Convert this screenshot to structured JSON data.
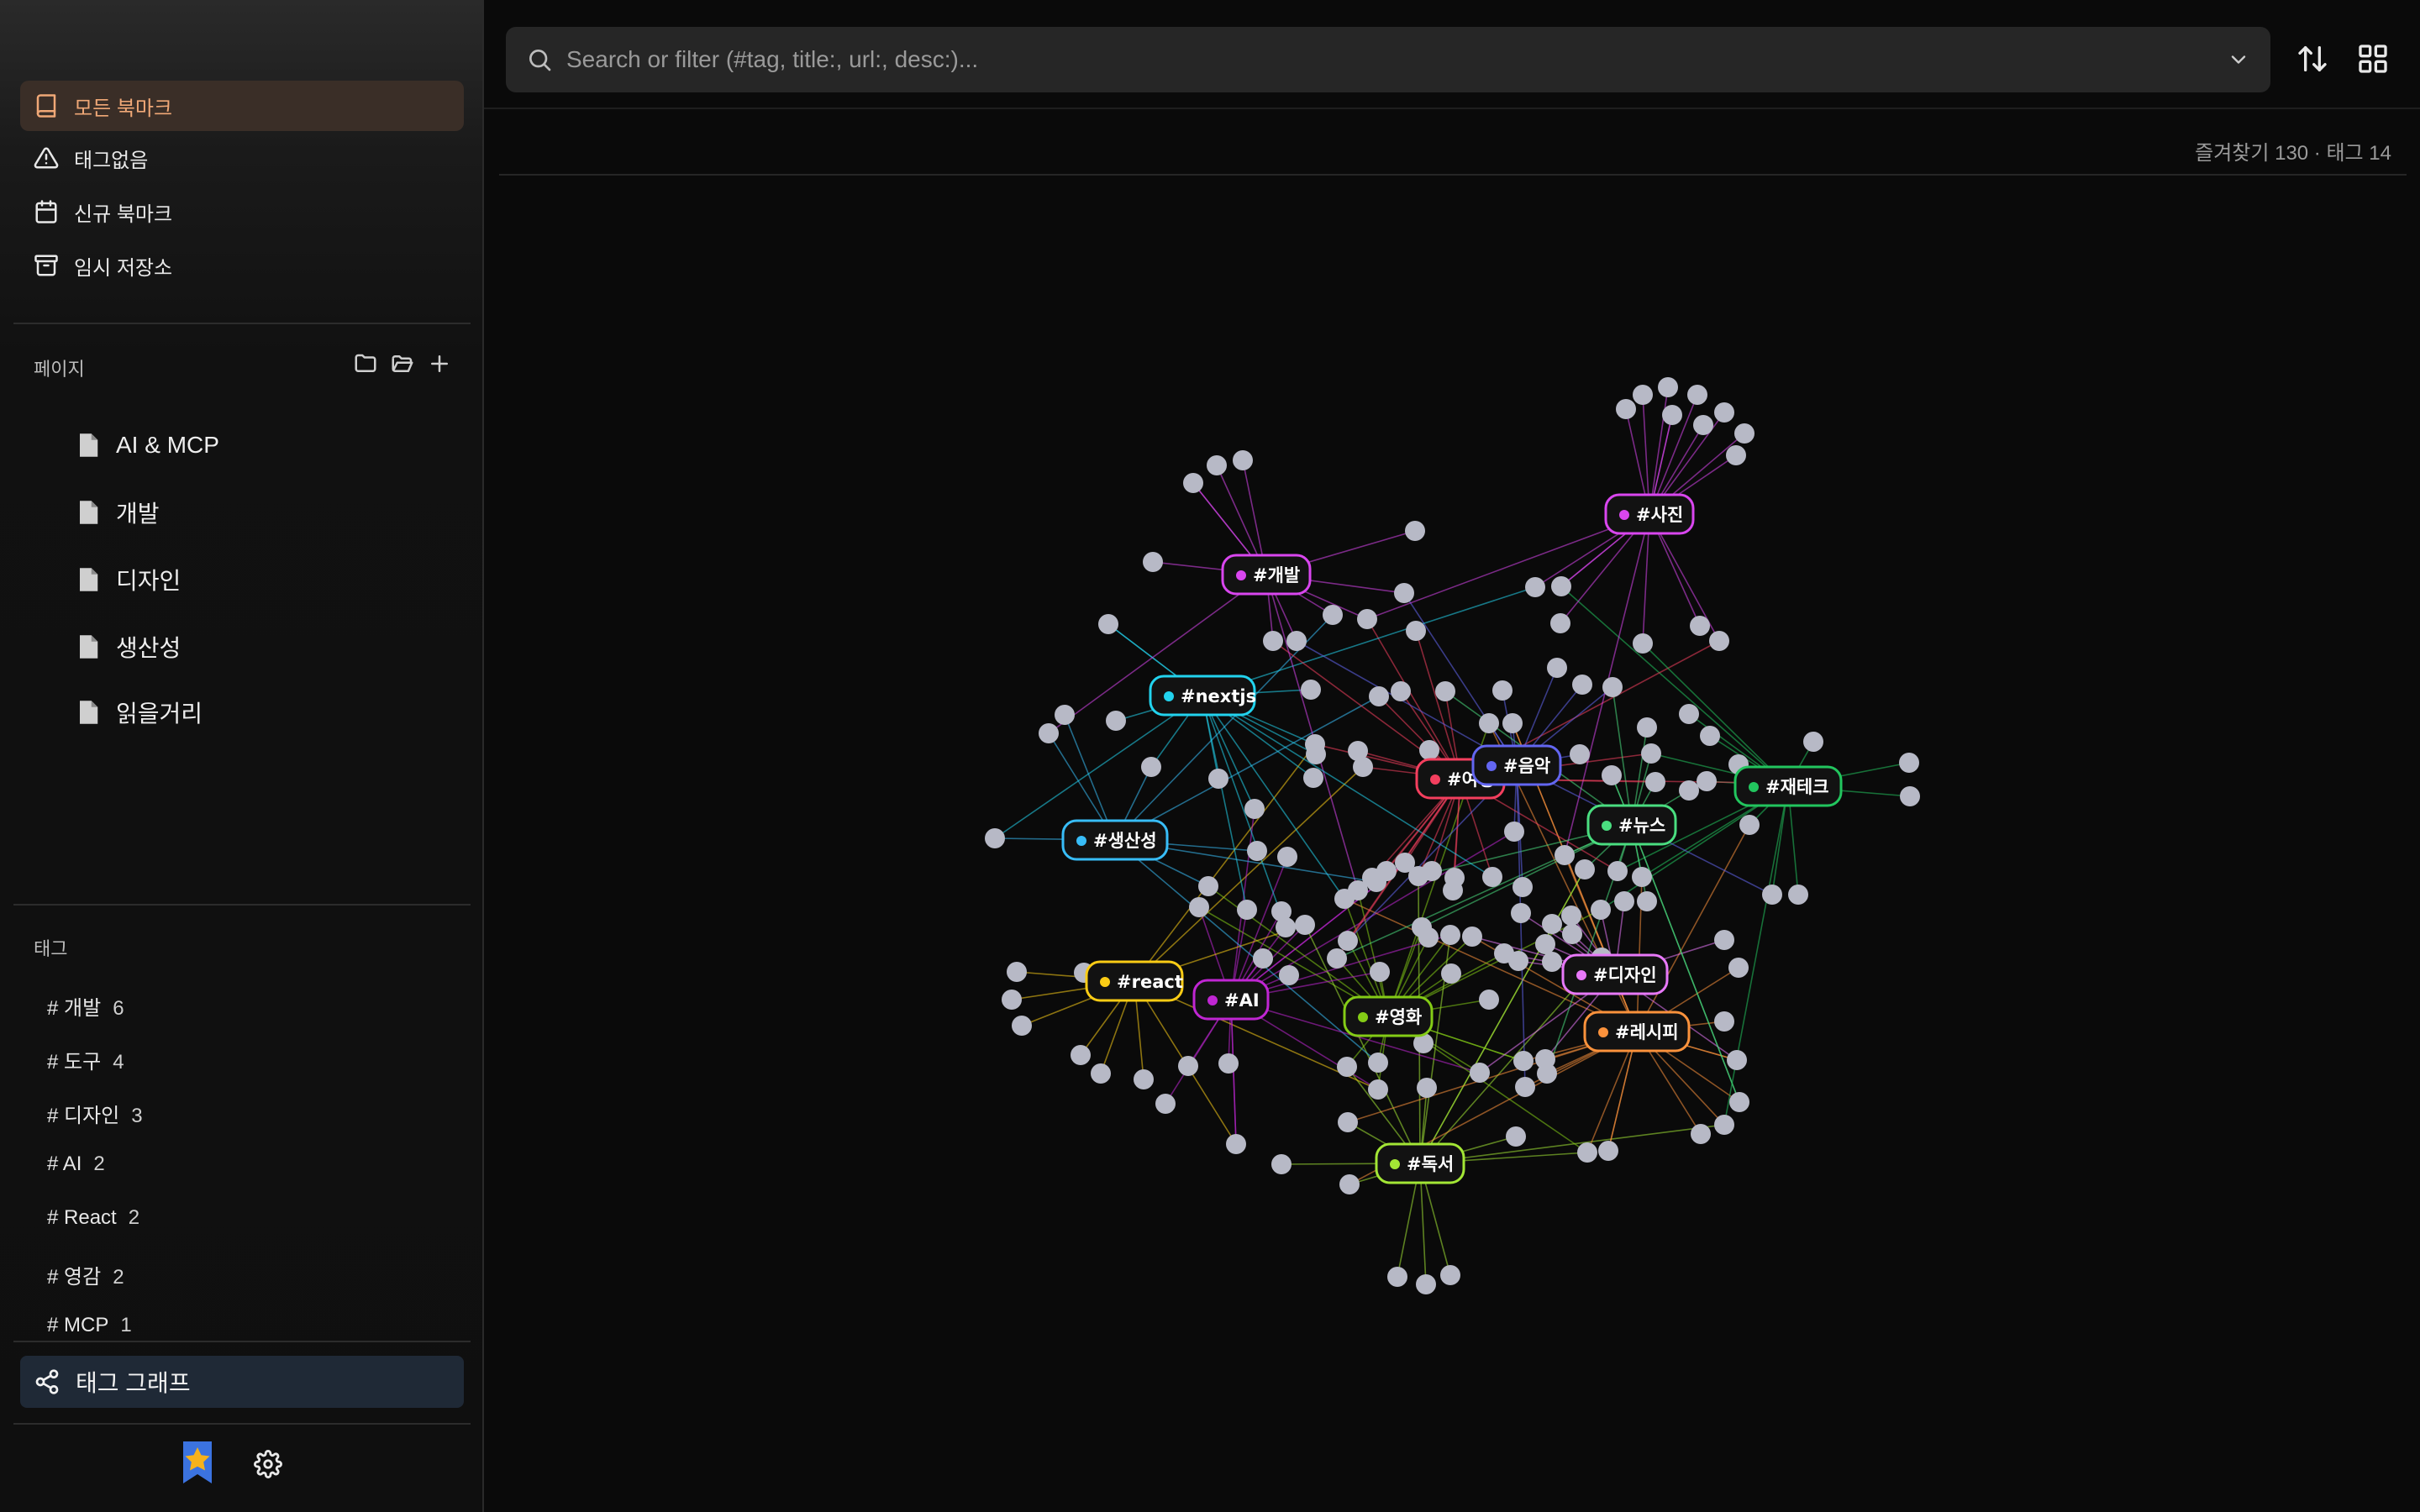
{
  "sidebar": {
    "nav": [
      {
        "label": "모든 북마크",
        "icon": "book-icon",
        "active": true
      },
      {
        "label": "태그없음",
        "icon": "warning-icon",
        "active": false
      },
      {
        "label": "신규 북마크",
        "icon": "calendar-icon",
        "active": false
      },
      {
        "label": "임시 저장소",
        "icon": "archive-icon",
        "active": false
      }
    ],
    "pages_title": "페이지",
    "pages": [
      {
        "label": "AI & MCP"
      },
      {
        "label": "개발"
      },
      {
        "label": "디자인"
      },
      {
        "label": "생산성"
      },
      {
        "label": "읽을거리"
      }
    ],
    "tags_title": "태그",
    "tags": [
      {
        "label": "# 개발",
        "count": "6"
      },
      {
        "label": "# 도구",
        "count": "4"
      },
      {
        "label": "# 디자인",
        "count": "3"
      },
      {
        "label": "# AI",
        "count": "2"
      },
      {
        "label": "# React",
        "count": "2"
      },
      {
        "label": "# 영감",
        "count": "2"
      },
      {
        "label": "# MCP",
        "count": "1"
      }
    ],
    "graph_button": "태그 그래프"
  },
  "search": {
    "placeholder": "Search or filter (#tag, title:, url:, desc:)..."
  },
  "stats": "즐겨찾기 130 · 태그 14",
  "graph": {
    "tags": [
      {
        "label": "#사진",
        "color": "#d946ef"
      },
      {
        "label": "#개발",
        "color": "#d946ef"
      },
      {
        "label": "#nextjs",
        "color": "#22d3ee"
      },
      {
        "label": "#여행",
        "color": "#f43f5e"
      },
      {
        "label": "#음악",
        "color": "#6366f1"
      },
      {
        "label": "#재테크",
        "color": "#22c55e"
      },
      {
        "label": "#뉴스",
        "color": "#4ade80"
      },
      {
        "label": "#생산성",
        "color": "#38bdf8"
      },
      {
        "label": "#react",
        "color": "#facc15"
      },
      {
        "label": "#AI",
        "color": "#c026d3"
      },
      {
        "label": "#영화",
        "color": "#84cc16"
      },
      {
        "label": "#디자인",
        "color": "#e879f9"
      },
      {
        "label": "#레시피",
        "color": "#fb923c"
      },
      {
        "label": "#독서",
        "color": "#a3e635"
      }
    ]
  }
}
